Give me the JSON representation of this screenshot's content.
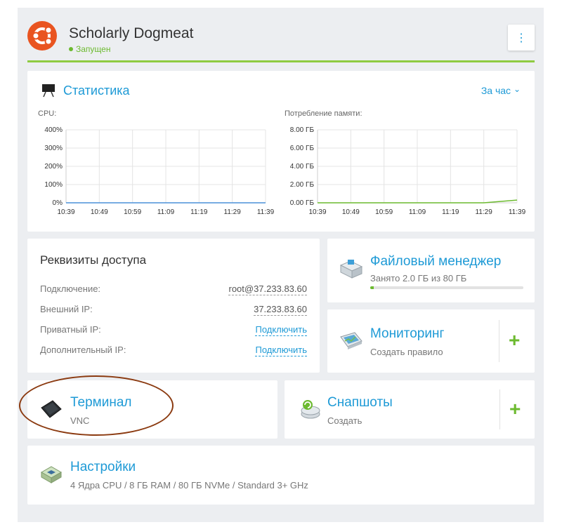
{
  "server": {
    "name": "Scholarly Dogmeat",
    "status": "Запущен",
    "menu_glyph": "⋮",
    "logo_icon": "ubuntu-logo",
    "accent_color": "#6cba2f",
    "link_color": "#1e9ad6"
  },
  "stats": {
    "title": "Статистика",
    "period": "За час",
    "period_chevron": "⌄",
    "cpu_label": "CPU:",
    "mem_label": "Потребление памяти:"
  },
  "chart_data": [
    {
      "type": "line",
      "title": "CPU:",
      "x": [
        "10:39",
        "10:49",
        "10:59",
        "11:09",
        "11:19",
        "11:29",
        "11:39"
      ],
      "yticks": [
        "400%",
        "300%",
        "200%",
        "100%",
        "0%"
      ],
      "ylim": [
        0,
        400
      ],
      "series": [
        {
          "values": [
            0,
            0,
            0,
            0,
            0,
            0,
            0
          ],
          "color": "#4a90d9"
        }
      ],
      "grid": true
    },
    {
      "type": "line",
      "title": "Потребление памяти:",
      "x": [
        "10:39",
        "10:49",
        "10:59",
        "11:09",
        "11:19",
        "11:29",
        "11:39"
      ],
      "yticks": [
        "8.00 ГБ",
        "6.00 ГБ",
        "4.00 ГБ",
        "2.00 ГБ",
        "0.00 ГБ"
      ],
      "ylim": [
        0,
        8
      ],
      "series": [
        {
          "values": [
            0,
            0,
            0,
            0,
            0,
            0,
            0.3
          ],
          "color": "#6cba2f"
        }
      ],
      "grid": true
    }
  ],
  "access": {
    "title": "Реквизиты доступа",
    "rows": [
      {
        "label": "Подключение:",
        "value": "root@37.233.83.60"
      },
      {
        "label": "Внешний IP:",
        "value": "37.233.83.60"
      },
      {
        "label": "Приватный IP:",
        "value": "Подключить"
      },
      {
        "label": "Дополнительный IP:",
        "value": "Подключить"
      }
    ]
  },
  "file_manager": {
    "title": "Файловый менеджер",
    "usage": "Занято 2.0 ГБ из 80 ГБ",
    "used_fraction": 0.025
  },
  "monitoring": {
    "title": "Мониторинг",
    "subtitle": "Создать правило",
    "plus": "+"
  },
  "terminal": {
    "title": "Терминал",
    "subtitle": "VNC"
  },
  "snapshots": {
    "title": "Снапшоты",
    "subtitle": "Создать",
    "plus": "+"
  },
  "settings": {
    "title": "Настройки",
    "subtitle": "4 Ядра CPU / 8 ГБ RAM / 80 ГБ NVMe / Standard 3+ GHz"
  }
}
